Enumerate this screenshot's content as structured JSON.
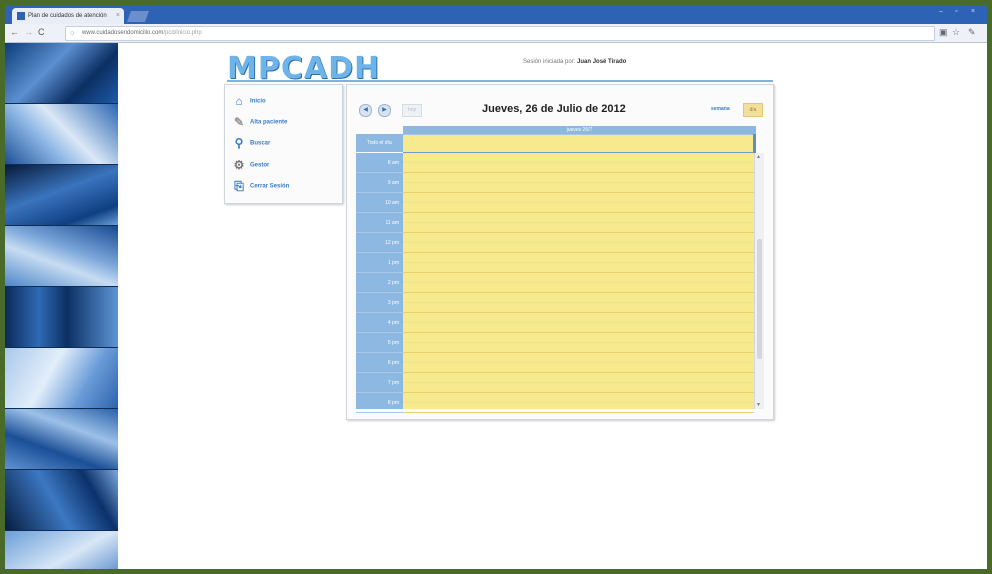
{
  "browser": {
    "tab_title": "Plan de cuidados de atención",
    "tab_close": "×",
    "url_host": "www.cuidadosendomicilio.com",
    "url_path": "/pcd/inicio.php",
    "window_controls": [
      "–",
      "▫",
      "×"
    ]
  },
  "header": {
    "logo": "MPCADH",
    "session_label": "Sesión iniciada por:",
    "session_user": "Juan José Tirado"
  },
  "menu": {
    "items": [
      {
        "label": "Inicio",
        "icon": "home-icon"
      },
      {
        "label": "Alta paciente",
        "icon": "pen-icon"
      },
      {
        "label": "Buscar",
        "icon": "magnifier-icon"
      },
      {
        "label": "Gestor",
        "icon": "gears-icon"
      },
      {
        "label": "Cerrar Sesión",
        "icon": "logout-icon"
      }
    ]
  },
  "calendar": {
    "prev": "◀",
    "next": "▶",
    "today_button": "hoy",
    "title": "Jueves, 26 de Julio de 2012",
    "week_view": "semana",
    "day_view": "día",
    "day_column": "jueves 26/7",
    "all_day": "Todo el día",
    "hours": [
      "8 am",
      "9 am",
      "10 am",
      "11 am",
      "12 pm",
      "1 pm",
      "2 pm",
      "3 pm",
      "4 pm",
      "5 pm",
      "6 pm",
      "7 pm",
      "8 pm"
    ]
  },
  "colors": {
    "brand": "#6fb4e8",
    "grid_yellow": "#f7e98d",
    "axis_blue": "#8cb8e2",
    "chrome_blue": "#2e62b4"
  }
}
